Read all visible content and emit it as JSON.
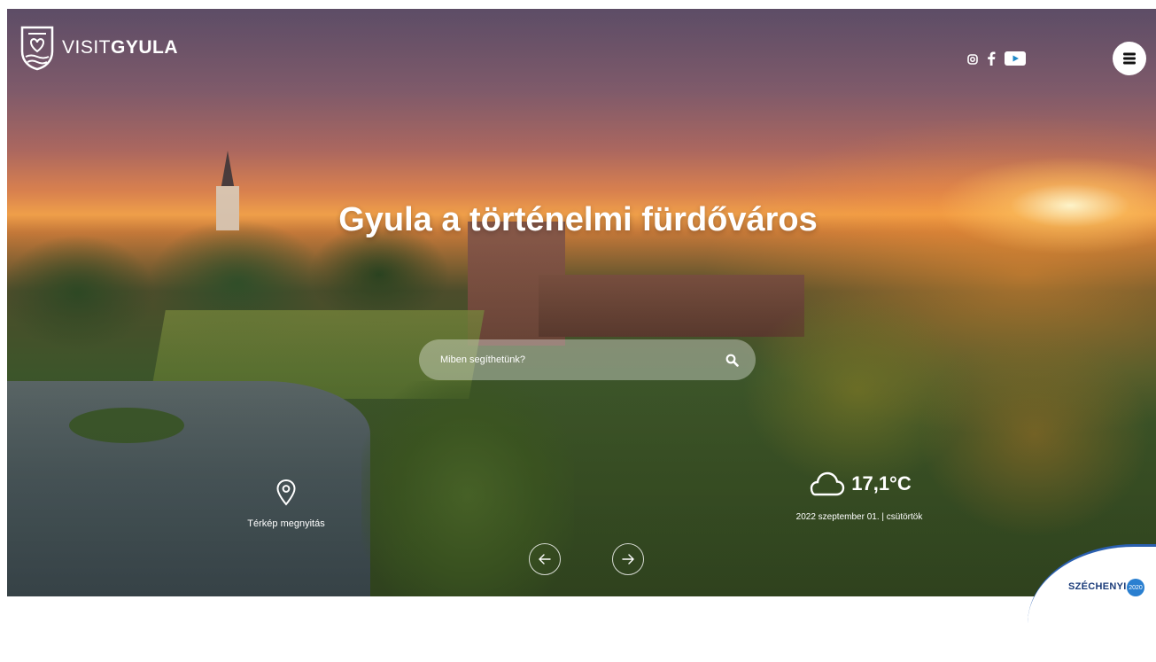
{
  "brand": {
    "light": "VISIT",
    "bold": "GYULA"
  },
  "hero": {
    "title": "Gyula a történelmi fürdőváros"
  },
  "social": [
    {
      "name": "instagram-icon"
    },
    {
      "name": "facebook-icon"
    },
    {
      "name": "youtube-icon"
    }
  ],
  "search": {
    "placeholder": "Miben segíthetünk?"
  },
  "map": {
    "label": "Térkép megnyitás"
  },
  "weather": {
    "temperature": "17,1°C",
    "date": "2022 szeptember 01. | csütörtök"
  },
  "sponsor": {
    "label": "SZÉCHENYI",
    "badge": "2020"
  },
  "colors": {
    "sponsor_blue": "#2a5fb0",
    "white": "#ffffff"
  }
}
